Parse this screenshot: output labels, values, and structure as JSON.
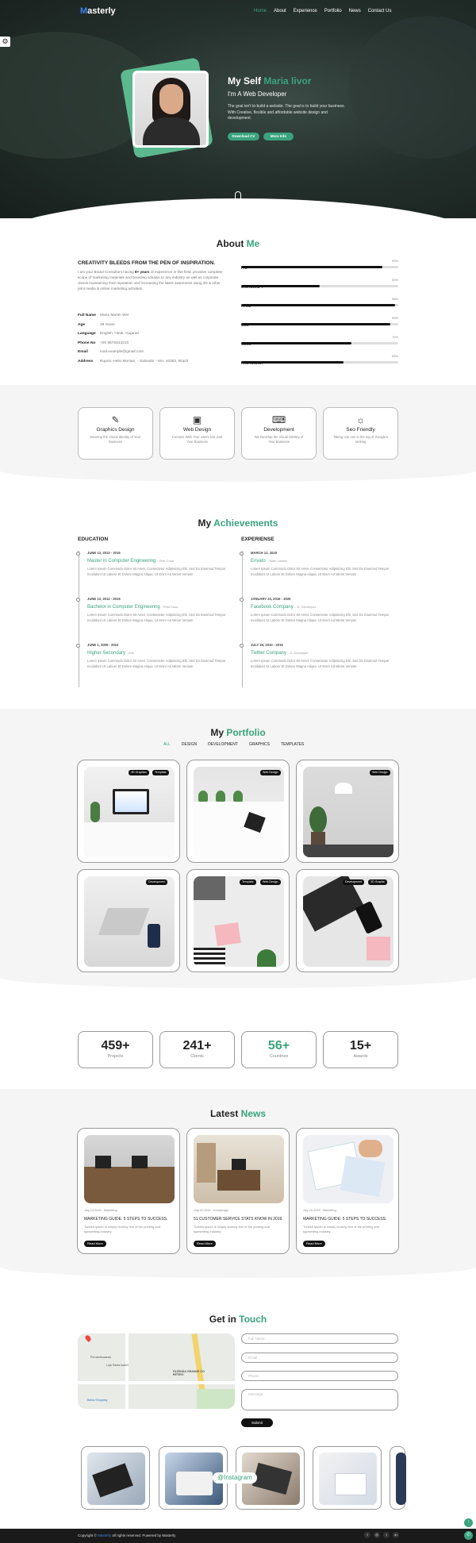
{
  "nav": {
    "logo_first": "M",
    "logo_rest": "asterly",
    "items": [
      "Home",
      "About",
      "Experience",
      "Portfolio",
      "News",
      "Contact Us"
    ]
  },
  "hero": {
    "title_prefix": "My Self",
    "title_name": "Maria livor",
    "subtitle": "I'm A Web Developer",
    "text": "The goal isn't to build a website. The goal is to build your business. With Creative, flexible and affordable website design and development.",
    "btn_cv": "Download CV",
    "btn_more": "More Info"
  },
  "about": {
    "title_a": "About",
    "title_b": "Me",
    "heading": "CREATIVITY BLEEDS FROM THE PEN OF INSPIRATION.",
    "text_1": "I am your Brand Consultant having",
    "text_bold": "8+ years",
    "text_2": "of experience in this field. provides complete scope of marketing materials and branding solution to any industry as well as corporate clients maintaining their reputation and increasing the latest awareness using 3D & other print media & online marketing activities.",
    "info": [
      {
        "k": "Full Name",
        "v": "Maria Martin Wer"
      },
      {
        "k": "Age",
        "v": "38 Years"
      },
      {
        "k": "Language",
        "v": "English, Hindi, Gujarati"
      },
      {
        "k": "Phone No",
        "v": "+00 9876543210"
      },
      {
        "k": "Email",
        "v": "mail.example@gmail.com"
      },
      {
        "k": "Address",
        "v": "Rupnic Helio Moriani, - Salvador - MA, 40362, Brazil"
      }
    ],
    "skills": [
      {
        "name": "PHP",
        "pct": "90%",
        "value": 90
      },
      {
        "name": "JAVASCRIPT",
        "pct": "50%",
        "value": 50
      },
      {
        "name": "HTML",
        "pct": "98%",
        "value": 98
      },
      {
        "name": "CSS",
        "pct": "95%",
        "value": 95
      },
      {
        "name": "SCSS",
        "pct": "70%",
        "value": 70
      },
      {
        "name": "PHOTOSHOP",
        "pct": "65%",
        "value": 65
      }
    ]
  },
  "services": [
    {
      "title": "Graphics Design",
      "desc": "Develop the Visual Identity of Your Business",
      "icon": "pen-tool-icon"
    },
    {
      "title": "Web Design",
      "desc": "Connect With Your Users Not Just Your Business",
      "icon": "web-design-icon"
    },
    {
      "title": "Development",
      "desc": "We Develop the Visual Identity of Your Business",
      "icon": "development-icon"
    },
    {
      "title": "Seo Friendly",
      "desc": "Taking one one in the top of Google's ranking",
      "icon": "seo-icon"
    }
  ],
  "achievements": {
    "title_a": "My",
    "title_b": "Achievements",
    "education_label": "EDUCATION",
    "experience_label": "EXPERIENSE",
    "desc": "Lorem Ipsum Commodo Dolor Sit Amet, Consectetur Adipisicing Elit, Sed Do Eiusmod Tempor Incididunt Ut Labore Et Dolore Magna Aliqua. Ut Enim Ad Minim Veniam",
    "education": [
      {
        "date": "JUNE 13, 2013 - 2016",
        "title": "Master in Computer Engineering",
        "where": "- Prist Cous"
      },
      {
        "date": "JUNE 13, 2013 - 2015",
        "title": "Bachelor in Computer Engineering",
        "where": "- Prist Cous"
      },
      {
        "date": "JUNE 1, 2009 - 2010",
        "title": "Higher Secondary",
        "where": "- Ahc"
      }
    ],
    "experience": [
      {
        "date": "MARCH 12, 2020",
        "title": "Envato",
        "where": "- Team Leader"
      },
      {
        "date": "JANUARY 23, 2016 - 2020",
        "title": "Facebook Company",
        "where": "- Sr. Developer"
      },
      {
        "date": "JULY 25, 2010 - 2015",
        "title": "Twitter Company",
        "where": "- Jr. Developer"
      }
    ]
  },
  "portfolio": {
    "title_a": "My",
    "title_b": "Portfolio",
    "filters": [
      "ALL",
      "DESIGN",
      "DEVELOPMENT",
      "GRAPHICS",
      "TEMPLATES"
    ],
    "items": [
      {
        "tags": [
          "3D Graphics",
          "Template"
        ]
      },
      {
        "tags": [
          "Web Design"
        ]
      },
      {
        "tags": [
          "Web Design"
        ]
      },
      {
        "tags": [
          "Development"
        ]
      },
      {
        "tags": [
          "Template",
          "Web Design"
        ]
      },
      {
        "tags": [
          "Development",
          "3D Graphic"
        ]
      }
    ]
  },
  "stats": [
    {
      "num": "459+",
      "label": "Projects"
    },
    {
      "num": "241+",
      "label": "Clients"
    },
    {
      "num": "56+",
      "label": "Countries"
    },
    {
      "num": "15+",
      "label": "Awards"
    }
  ],
  "news": {
    "title_a": "Latest",
    "title_b": "News",
    "items": [
      {
        "meta": "July 15,2019 - Marketing",
        "title": "MARKETING GUIDE: 5 STEPS TO SUCCESS.",
        "desc": "Turkish ipsum is simply dummy text of the printing and typesetting industry.",
        "btn": "Read More"
      },
      {
        "meta": "July 22,2019 - Knowledge",
        "title": "51 CUSTOMER SERVICE STATS KNOW IN 2019.",
        "desc": "Turkish ipsum is simply dummy text of the printing and typesetting industry.",
        "btn": "Read More"
      },
      {
        "meta": "July 15,2019 - Marketing",
        "title": "MARKETING GUIDE: 5 STEPS TO SUCCESS.",
        "desc": "Turkish ipsum is simply dummy text of the printing and typesetting industry.",
        "btn": "Read More"
      }
    ]
  },
  "contact": {
    "title_a": "Get in",
    "title_b": "Touch",
    "fields": [
      "Full Name",
      "Email",
      "Phone",
      "Message"
    ],
    "submit": "Submit",
    "map_labels": [
      "Pernambucanas",
      "Loja Santa Isabel",
      "FAZENDA GRANDE DO RETIRO",
      "Bahia Shopping"
    ]
  },
  "instagram": {
    "label": "@Instagram"
  },
  "footer": {
    "copy_pre": "Copyright ©",
    "brand": "Masterly",
    "copy_post": "all rights reserved. Powered by Masterly",
    "social": [
      "f",
      "◎",
      "t",
      "in"
    ]
  },
  "colors": {
    "accent": "#3aa37e",
    "logo": "#3b82f6",
    "dark": "#1a1a1a"
  }
}
